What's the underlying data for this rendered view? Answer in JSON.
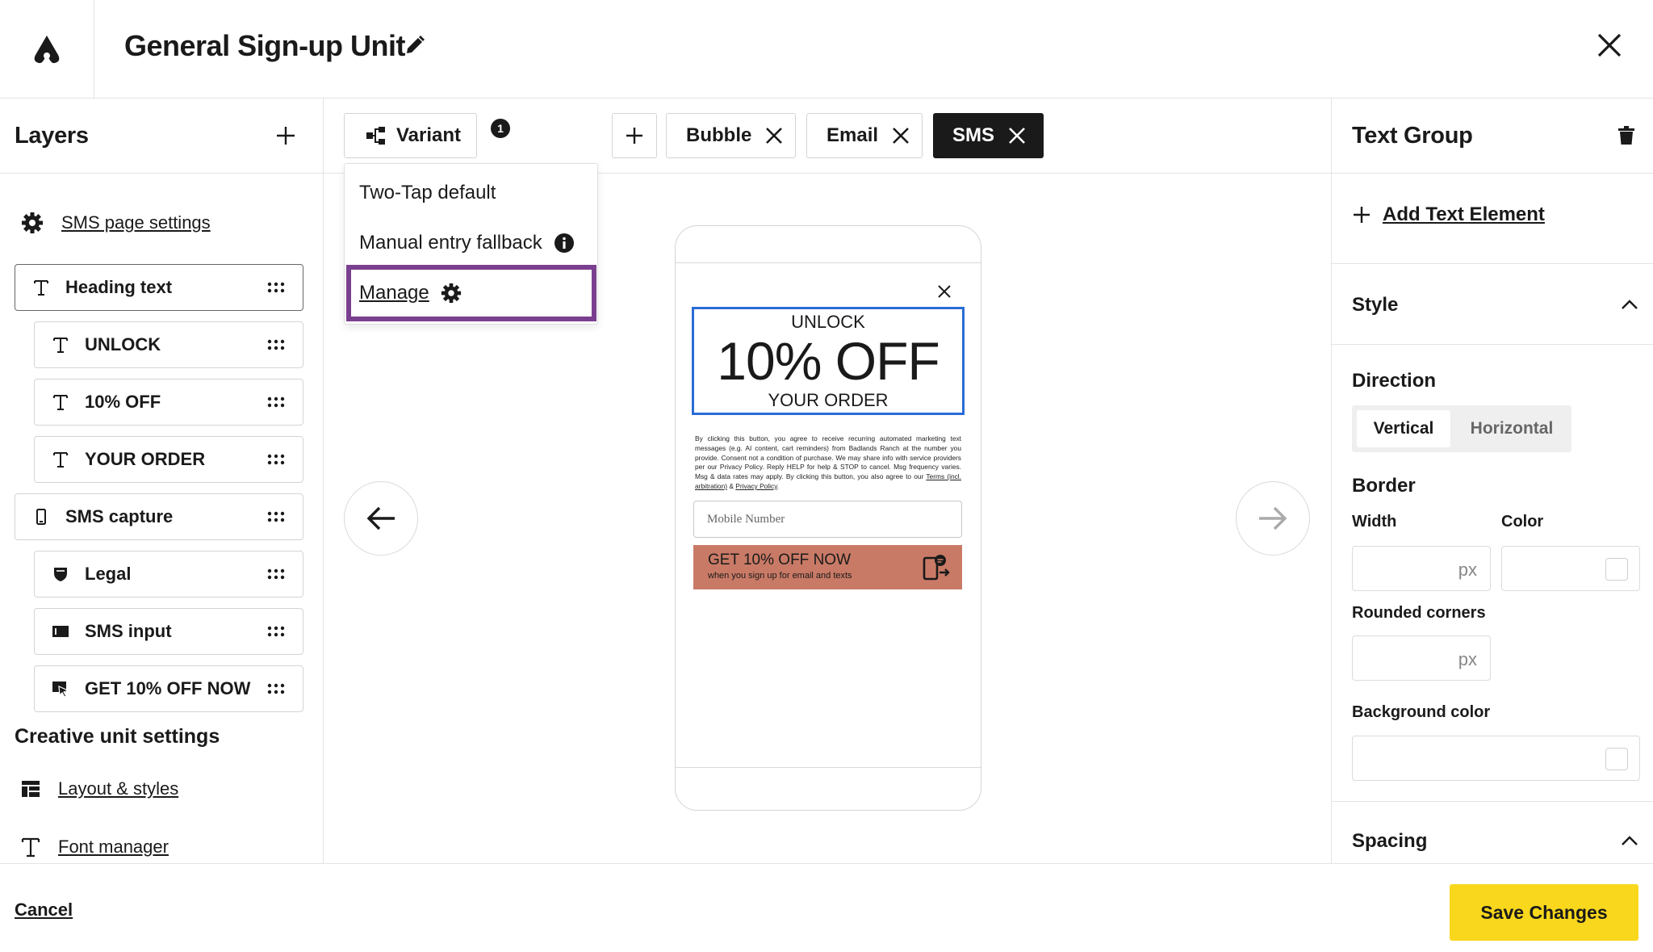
{
  "header": {
    "title": "General Sign-up Unit"
  },
  "layers_panel": {
    "title": "Layers",
    "page_settings_link": "SMS page settings",
    "items": [
      {
        "label": "Heading text",
        "icon": "text-icon"
      },
      {
        "label": "UNLOCK",
        "icon": "text-icon"
      },
      {
        "label": "10% OFF",
        "icon": "text-icon"
      },
      {
        "label": "YOUR ORDER",
        "icon": "text-icon"
      },
      {
        "label": "SMS capture",
        "icon": "phone-icon"
      },
      {
        "label": "Legal",
        "icon": "shield-icon"
      },
      {
        "label": "SMS input",
        "icon": "input-icon"
      },
      {
        "label": "GET 10% OFF NOW",
        "icon": "button-cursor-icon"
      }
    ],
    "creative_settings_title": "Creative unit settings",
    "layout_link": "Layout & styles",
    "font_link": "Font manager"
  },
  "toolbar": {
    "variant_label": "Variant",
    "variant_badge": "1",
    "tabs": [
      {
        "label": "Bubble",
        "active": false
      },
      {
        "label": "Email",
        "active": false
      },
      {
        "label": "SMS",
        "active": true
      }
    ]
  },
  "variant_menu": {
    "items": [
      "Two-Tap default",
      "Manual entry fallback",
      "Manage"
    ]
  },
  "preview": {
    "heading_line1": "UNLOCK",
    "heading_line2": "10% OFF",
    "heading_line3": "YOUR ORDER",
    "legal_text": "By clicking this button, you agree to receive recurring automated marketing text messages (e.g. AI content, cart reminders) from Badlands Ranch at the number you provide. Consent not a condition of purchase. We may share info with service providers per our Privacy Policy. Reply HELP for help & STOP to cancel. Msg frequency varies. Msg & data rates may apply. By clicking this button, you also agree to our ",
    "legal_link_terms": "Terms (incl. arbitration)",
    "legal_and": " & ",
    "legal_link_privacy": "Privacy Policy",
    "legal_end": ".",
    "input_placeholder": "Mobile Number",
    "cta_title": "GET 10% OFF NOW",
    "cta_subtitle": "when you sign up for email and texts",
    "cta_color": "#c97a66"
  },
  "properties_panel": {
    "title": "Text Group",
    "add_text": "Add Text Element",
    "style_title": "Style",
    "direction_label": "Direction",
    "direction_options": [
      "Vertical",
      "Horizontal"
    ],
    "direction_selected": "Vertical",
    "border_label": "Border",
    "width_label": "Width",
    "color_label": "Color",
    "px_unit": "px",
    "rounded_label": "Rounded corners",
    "bg_label": "Background color",
    "spacing_title": "Spacing"
  },
  "footer": {
    "cancel": "Cancel",
    "save": "Save Changes",
    "save_color": "#f9d71c"
  },
  "colors": {
    "manage_highlight": "#7b3f8f",
    "selection_blue": "#2a6cd6"
  }
}
